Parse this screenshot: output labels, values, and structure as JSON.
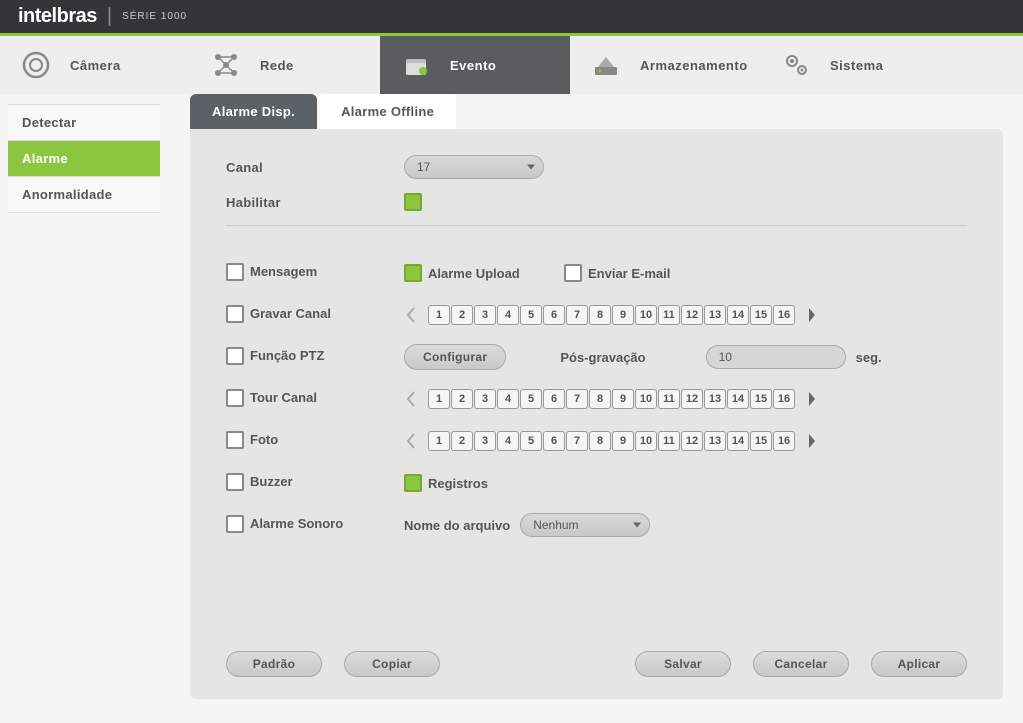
{
  "brand": {
    "name": "intelbras",
    "series": "SÉRIE 1000"
  },
  "topnav": {
    "camera": "Câmera",
    "network": "Rede",
    "event": "Evento",
    "storage": "Armazenamento",
    "system": "Sistema"
  },
  "sidebar": {
    "detectar": "Detectar",
    "alarme": "Alarme",
    "anormalidade": "Anormalidade"
  },
  "tabs": {
    "alarme_disp": "Alarme Disp.",
    "alarme_offline": "Alarme Offline"
  },
  "form": {
    "canal_label": "Canal",
    "canal_value": "17",
    "habilitar_label": "Habilitar",
    "mensagem": "Mensagem",
    "alarme_upload": "Alarme Upload",
    "enviar_email": "Enviar E-mail",
    "gravar_canal": "Gravar Canal",
    "funcao_ptz": "Função PTZ",
    "configurar": "Configurar",
    "pos_gravacao": "Pós-gravação",
    "pos_value": "10",
    "seg": "seg.",
    "tour_canal": "Tour Canal",
    "foto": "Foto",
    "buzzer": "Buzzer",
    "registros": "Registros",
    "alarme_sonoro": "Alarme Sonoro",
    "nome_arquivo": "Nome do arquivo",
    "nome_value": "Nenhum",
    "channels": [
      "1",
      "2",
      "3",
      "4",
      "5",
      "6",
      "7",
      "8",
      "9",
      "10",
      "11",
      "12",
      "13",
      "14",
      "15",
      "16"
    ]
  },
  "footer": {
    "padrao": "Padrão",
    "copiar": "Copiar",
    "salvar": "Salvar",
    "cancelar": "Cancelar",
    "aplicar": "Aplicar"
  }
}
